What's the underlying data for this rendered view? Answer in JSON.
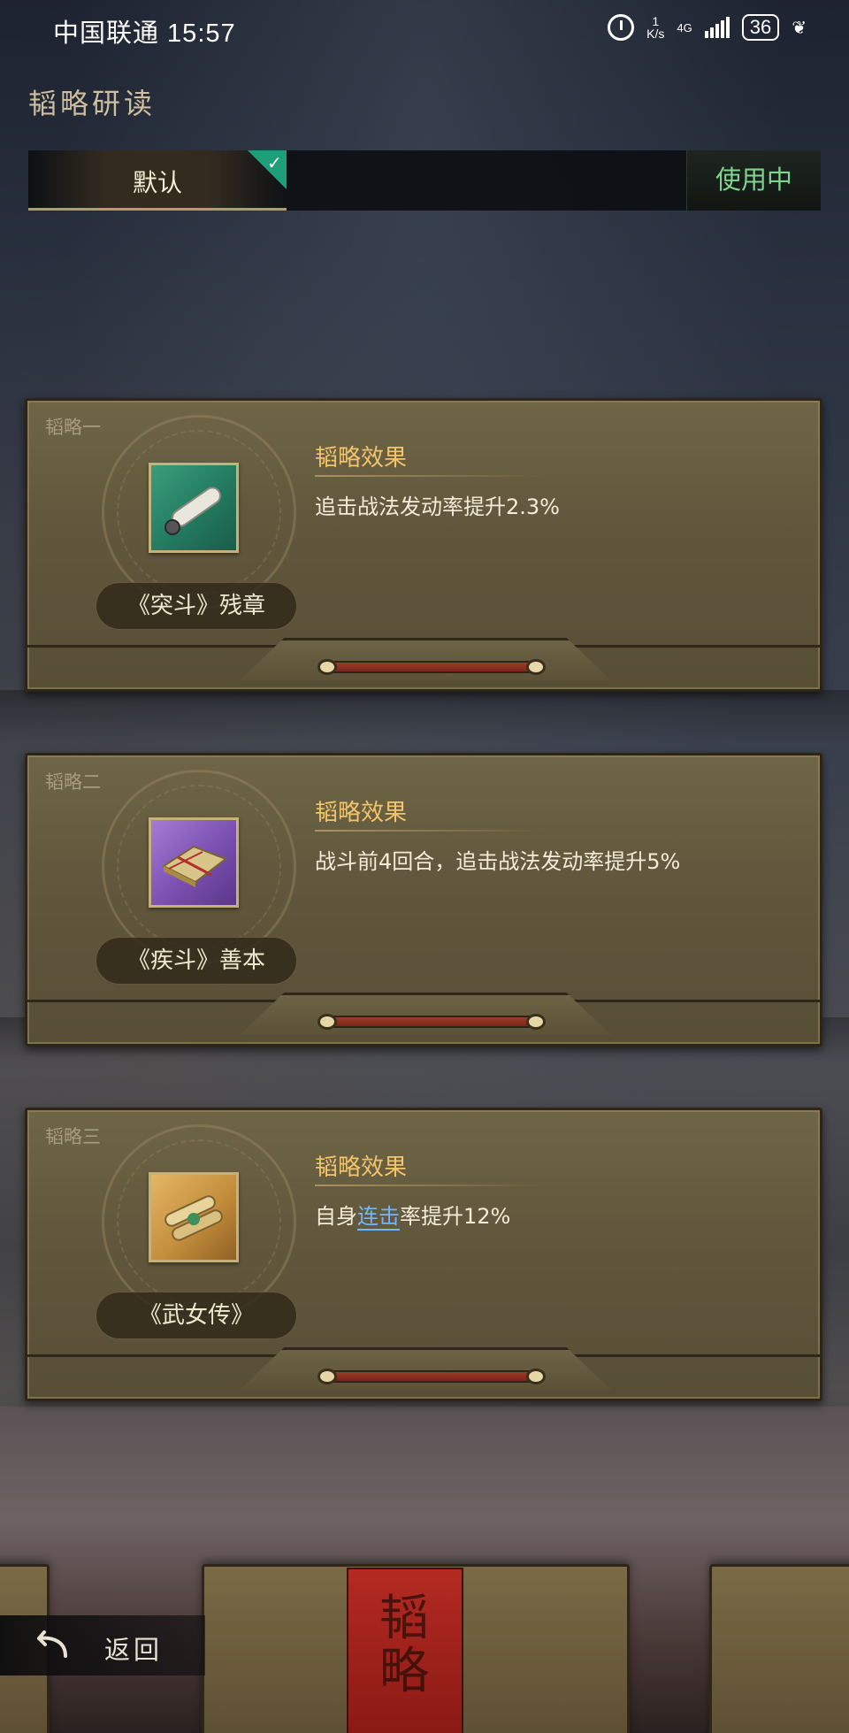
{
  "status_bar": {
    "carrier_time": "中国联通 15:57",
    "net_speed_value": "1",
    "net_speed_unit": "K/s",
    "network_type": "4G",
    "battery": "36"
  },
  "page": {
    "title": "韬略研读"
  },
  "tabs": {
    "active_label": "默认",
    "status_button": "使用中"
  },
  "cards": [
    {
      "slot": "韬略一",
      "icon": "scroll-icon",
      "item_name": "《突斗》残章",
      "effect_title": "韬略效果",
      "effect_text": "追击战法发动率提升2.3%"
    },
    {
      "slot": "韬略二",
      "icon": "bound-book-icon",
      "item_name": "《疾斗》善本",
      "effect_title": "韬略效果",
      "effect_text": "战斗前4回合，追击战法发动率提升5%"
    },
    {
      "slot": "韬略三",
      "icon": "bamboo-scrolls-icon",
      "item_name": "《武女传》",
      "effect_title": "韬略效果",
      "effect_text_pre": "自身",
      "effect_text_link": "连击",
      "effect_text_post": "率提升12%"
    }
  ],
  "footer": {
    "back_label": "返回",
    "book_mark": "韬略"
  },
  "colors": {
    "accent_gold": "#f2c56b",
    "in_use_green": "#7fd58e",
    "check_teal": "#1f9e7a",
    "link_blue": "#6fb7ff",
    "card_bronze": "#62583d"
  }
}
